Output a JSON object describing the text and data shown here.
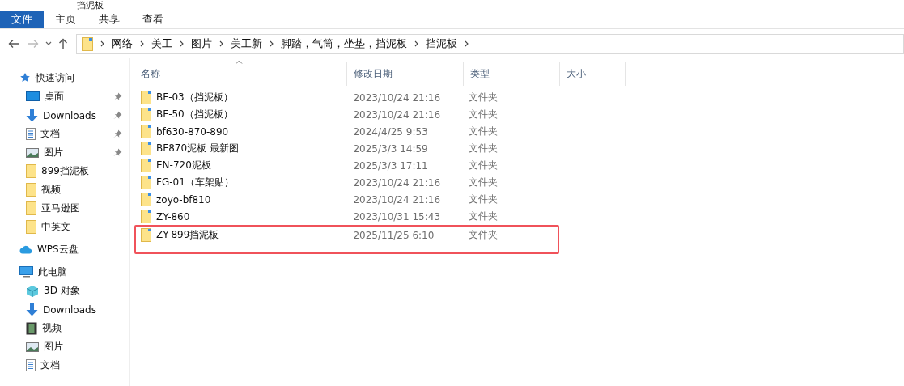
{
  "window": {
    "title": "挡泥板"
  },
  "ribbon_tabs": [
    {
      "label": "文件",
      "selected": true
    },
    {
      "label": "主页",
      "selected": false
    },
    {
      "label": "共享",
      "selected": false
    },
    {
      "label": "查看",
      "selected": false
    }
  ],
  "address_bar": {
    "path": [
      "网络",
      "美工",
      "图片",
      "美工新",
      "脚踏，气筒，坐垫，挡泥板",
      "挡泥板"
    ]
  },
  "sidebar": {
    "groups": [
      {
        "label": "快速访问",
        "kind": "star",
        "children": [
          {
            "label": "桌面",
            "kind": "desktop",
            "pinned": true
          },
          {
            "label": "Downloads",
            "kind": "download",
            "pinned": true
          },
          {
            "label": "文档",
            "kind": "document",
            "pinned": true
          },
          {
            "label": "图片",
            "kind": "picture",
            "pinned": true
          },
          {
            "label": "899挡泥板",
            "kind": "folder",
            "pinned": false
          },
          {
            "label": "视频",
            "kind": "folder",
            "pinned": false
          },
          {
            "label": "亚马逊图",
            "kind": "folder",
            "pinned": false
          },
          {
            "label": "中英文",
            "kind": "folder",
            "pinned": false
          }
        ]
      },
      {
        "label": "WPS云盘",
        "kind": "cloud"
      },
      {
        "label": "此电脑",
        "kind": "pc",
        "children": [
          {
            "label": "3D 对象",
            "kind": "cube",
            "pinned": false
          },
          {
            "label": "Downloads",
            "kind": "download",
            "pinned": false
          },
          {
            "label": "视频",
            "kind": "video",
            "pinned": false
          },
          {
            "label": "图片",
            "kind": "picture",
            "pinned": false
          },
          {
            "label": "文档",
            "kind": "document",
            "pinned": false
          }
        ]
      }
    ]
  },
  "table": {
    "columns": [
      "名称",
      "修改日期",
      "类型",
      "大小"
    ],
    "rows": [
      {
        "name": "BF-03（挡泥板）",
        "modified": "2023/10/24 21:16",
        "type": "文件夹",
        "highlighted": false
      },
      {
        "name": "BF-50（挡泥板）",
        "modified": "2023/10/24 21:16",
        "type": "文件夹",
        "highlighted": false
      },
      {
        "name": "bf630-870-890",
        "modified": "2024/4/25 9:53",
        "type": "文件夹",
        "highlighted": false
      },
      {
        "name": "BF870泥板 最新图",
        "modified": "2025/3/3 14:59",
        "type": "文件夹",
        "highlighted": false
      },
      {
        "name": "EN-720泥板",
        "modified": "2025/3/3 17:11",
        "type": "文件夹",
        "highlighted": false
      },
      {
        "name": "FG-01（车架贴）",
        "modified": "2023/10/24 21:16",
        "type": "文件夹",
        "highlighted": false
      },
      {
        "name": "zoyo-bf810",
        "modified": "2023/10/24 21:16",
        "type": "文件夹",
        "highlighted": false
      },
      {
        "name": "ZY-860",
        "modified": "2023/10/31 15:43",
        "type": "文件夹",
        "highlighted": false
      },
      {
        "name": "ZY-899挡泥板",
        "modified": "2025/11/25 6:10",
        "type": "文件夹",
        "highlighted": true
      }
    ]
  }
}
